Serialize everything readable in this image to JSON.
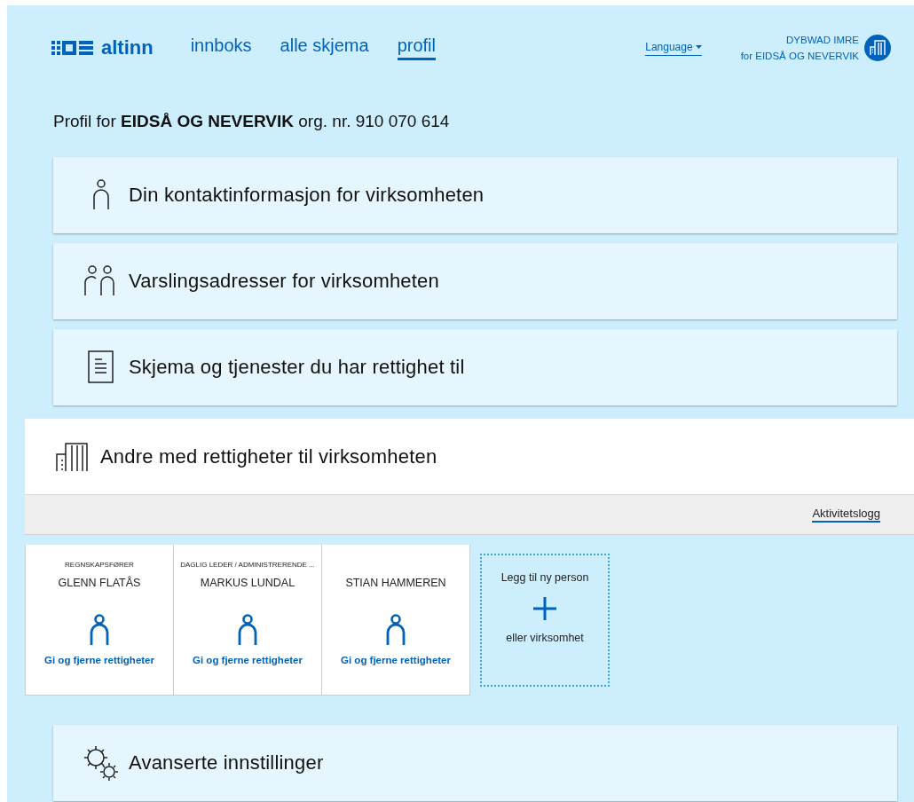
{
  "header": {
    "logo_text": "altinn",
    "nav": [
      {
        "label": "innboks",
        "selected": false
      },
      {
        "label": "alle skjema",
        "selected": false
      },
      {
        "label": "profil",
        "selected": true
      }
    ],
    "language": "Language",
    "user": {
      "name": "DYBWAD IMRE",
      "org": "for EIDSÅ OG NEVERVIK"
    }
  },
  "profile_line": "Profil for **EIDSÅ OG NEVERVIK** org. nr. 910 070 614",
  "sections": [
    {
      "kind": "person",
      "title": "Din kontaktinformasjon for virksomheten",
      "expanded": false
    },
    {
      "kind": "people",
      "title": "Varslingsadresser for virksomheten",
      "expanded": false
    },
    {
      "kind": "document",
      "title": "Skjema og tjenester du har rettighet til",
      "expanded": false
    },
    {
      "kind": "building",
      "title": "Andre med rettigheter til virksomheten",
      "expanded": true,
      "activity_log": "Aktivitetslogg",
      "people": [
        {
          "role": "REGNSKAPSFØRER",
          "name": "GLENN FLATÅS",
          "link": "Gi og fjerne rettigheter"
        },
        {
          "role": "DAGLIG LEDER / ADMINISTRERENDE ...",
          "name": "MARKUS LUNDAL",
          "link": "Gi og fjerne rettigheter"
        },
        {
          "name": "STIAN HAMMEREN",
          "link": "Gi og fjerne rettigheter"
        }
      ],
      "add": {
        "title": "Legg til ny person",
        "subtitle": "eller virksomhet"
      }
    },
    {
      "kind": "gears",
      "title": "Avanserte innstillinger",
      "expanded": false
    }
  ]
}
